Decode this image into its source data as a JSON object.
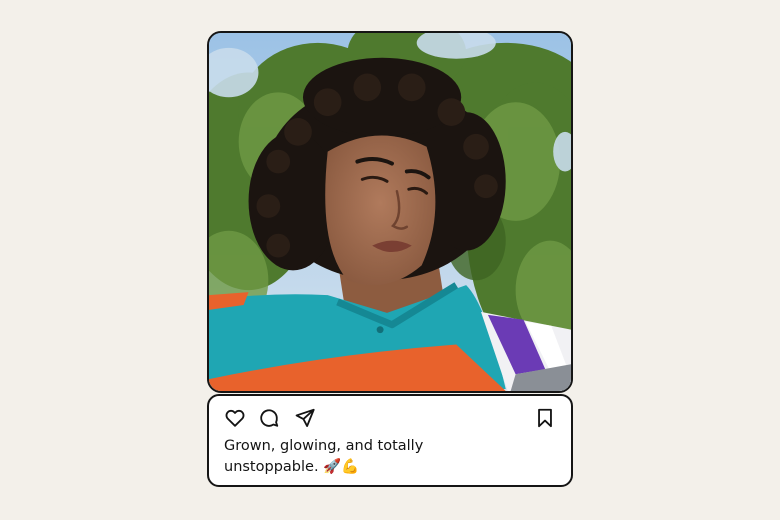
{
  "post": {
    "image_icon": "photo",
    "caption_line1": "Grown, glowing, and totally",
    "caption_line2": "unstoppable. 🚀💪"
  },
  "actions": {
    "like_icon": "heart-icon",
    "comment_icon": "comment-icon",
    "share_icon": "paper-plane-icon",
    "save_icon": "bookmark-icon"
  },
  "colors": {
    "background": "#f3f0ea",
    "border": "#151515",
    "card": "#ffffff",
    "text": "#141414"
  }
}
